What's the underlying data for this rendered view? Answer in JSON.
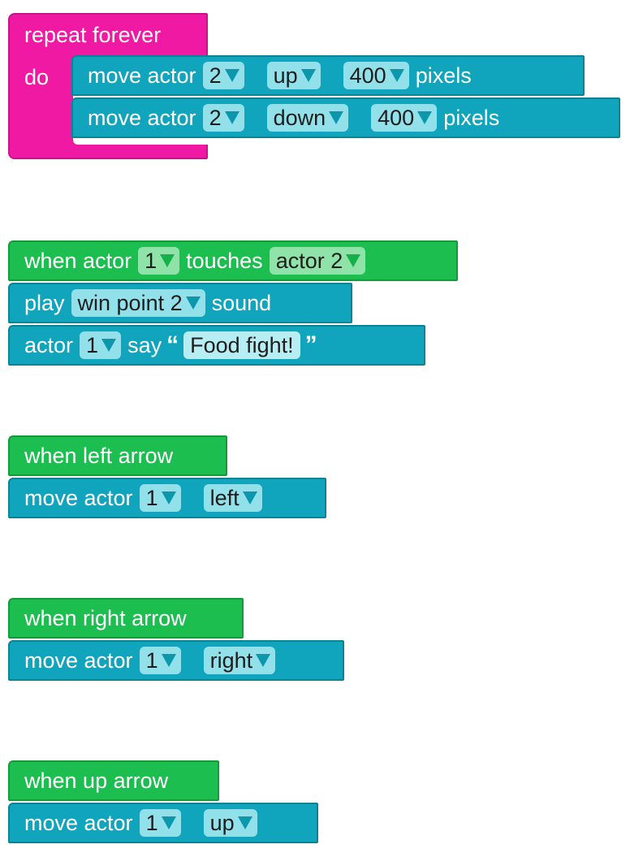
{
  "repeat": {
    "title": "repeat forever",
    "do_label": "do",
    "steps": [
      {
        "text": "move actor",
        "actor": "2",
        "direction": "up",
        "amount": "400",
        "unit": "pixels"
      },
      {
        "text": "move actor",
        "actor": "2",
        "direction": "down",
        "amount": "400",
        "unit": "pixels"
      }
    ]
  },
  "touch": {
    "when": "when actor",
    "actor": "1",
    "touches": "touches",
    "target": "actor 2",
    "play": "play",
    "sound_name": "win point 2",
    "sound": "sound",
    "actor_label": "actor",
    "say_actor": "1",
    "say": "say",
    "open_quote": "“",
    "message": "Food fight!",
    "close_quote": "”"
  },
  "left": {
    "event": "when left arrow",
    "move": "move actor",
    "actor": "1",
    "direction": "left"
  },
  "right": {
    "event": "when right arrow",
    "move": "move actor",
    "actor": "1",
    "direction": "right"
  },
  "up": {
    "event": "when up arrow",
    "move": "move actor",
    "actor": "1",
    "direction": "up"
  },
  "colors": {
    "event": "#1cbf4f",
    "action": "#10a5bd",
    "loop": "#f019a4"
  }
}
